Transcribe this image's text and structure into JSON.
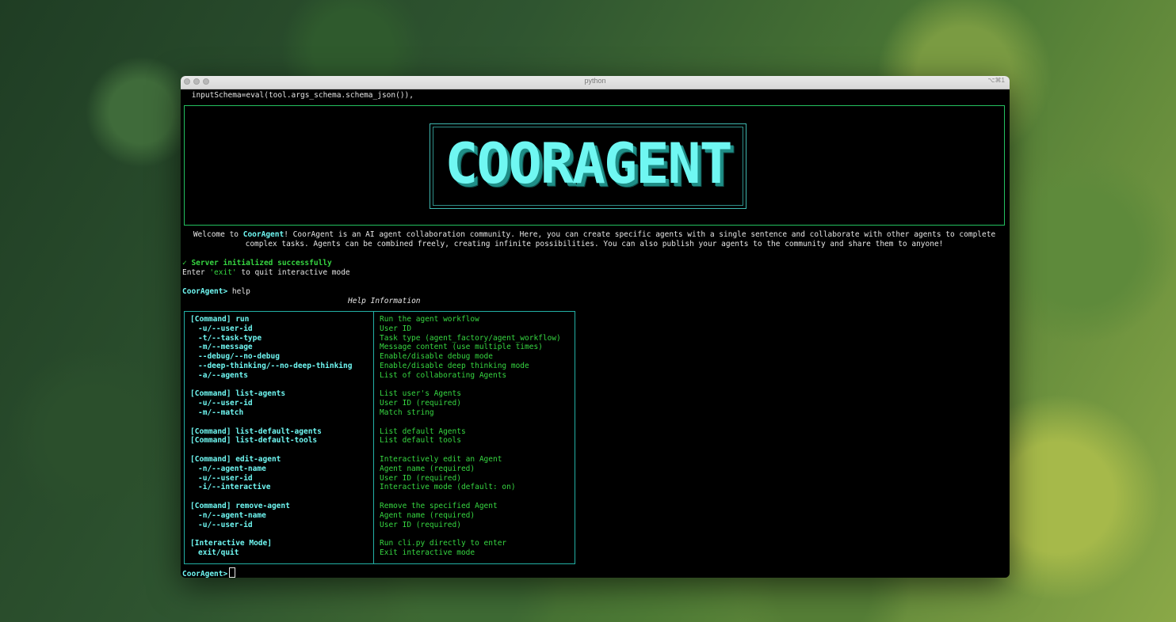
{
  "window": {
    "title": "python",
    "shortcut": "⌥⌘1"
  },
  "terminal": {
    "first_line": " inputSchema=eval(tool.args_schema.schema_json()),",
    "logo": "COORAGENT",
    "welcome": {
      "prefix": "Welcome to ",
      "brand": "CoorAgent",
      "suffix": "! CoorAgent is an AI agent collaboration community. Here, you can create specific agents with a single sentence and collaborate with other agents to complete complex tasks. Agents can be combined freely, creating infinite possibilities. You can also publish your agents to the community and share them to anyone!"
    },
    "server_status": "✓ Server initialized successfully",
    "exit_hint": {
      "prefix": "Enter ",
      "keyword": "'exit'",
      "suffix": " to quit interactive mode"
    },
    "prompt": "CoorAgent>",
    "command": " help",
    "help_title": "Help Information",
    "final_prompt": "CoorAgent>"
  },
  "help": [
    {
      "left": "[Command] run",
      "right": "Run the agent workflow",
      "kind": "cmd"
    },
    {
      "left": "-u/--user-id",
      "right": "User ID",
      "kind": "opt"
    },
    {
      "left": "-t/--task-type",
      "right": "Task type (agent_factory/agent_workflow)",
      "kind": "opt"
    },
    {
      "left": "-m/--message",
      "right": "Message content (use multiple times)",
      "kind": "opt"
    },
    {
      "left": "--debug/--no-debug",
      "right": "Enable/disable debug mode",
      "kind": "opt"
    },
    {
      "left": "--deep-thinking/--no-deep-thinking",
      "right": "Enable/disable deep thinking mode",
      "kind": "opt"
    },
    {
      "left": "-a/--agents",
      "right": "List of collaborating Agents",
      "kind": "opt"
    },
    {
      "left": "",
      "right": "",
      "kind": "blank"
    },
    {
      "left": "[Command] list-agents",
      "right": "List user's Agents",
      "kind": "cmd"
    },
    {
      "left": "-u/--user-id",
      "right": "User ID (required)",
      "kind": "opt"
    },
    {
      "left": "-m/--match",
      "right": "Match string",
      "kind": "opt"
    },
    {
      "left": "",
      "right": "",
      "kind": "blank"
    },
    {
      "left": "[Command] list-default-agents",
      "right": "List default Agents",
      "kind": "cmd"
    },
    {
      "left": "[Command] list-default-tools",
      "right": "List default tools",
      "kind": "cmd"
    },
    {
      "left": "",
      "right": "",
      "kind": "blank"
    },
    {
      "left": "[Command] edit-agent",
      "right": "Interactively edit an Agent",
      "kind": "cmd"
    },
    {
      "left": "-n/--agent-name",
      "right": "Agent name (required)",
      "kind": "opt"
    },
    {
      "left": "-u/--user-id",
      "right": "User ID (required)",
      "kind": "opt"
    },
    {
      "left": "-i/--interactive",
      "right": "Interactive mode (default: on)",
      "kind": "opt"
    },
    {
      "left": "",
      "right": "",
      "kind": "blank"
    },
    {
      "left": "[Command] remove-agent",
      "right": "Remove the specified Agent",
      "kind": "cmd"
    },
    {
      "left": "-n/--agent-name",
      "right": "Agent name (required)",
      "kind": "opt"
    },
    {
      "left": "-u/--user-id",
      "right": "User ID (required)",
      "kind": "opt"
    },
    {
      "left": "",
      "right": "",
      "kind": "blank"
    },
    {
      "left": "[Interactive Mode]",
      "right": "Run cli.py directly to enter",
      "kind": "cmd"
    },
    {
      "left": "exit/quit",
      "right": "Exit interactive mode",
      "kind": "opt"
    }
  ]
}
